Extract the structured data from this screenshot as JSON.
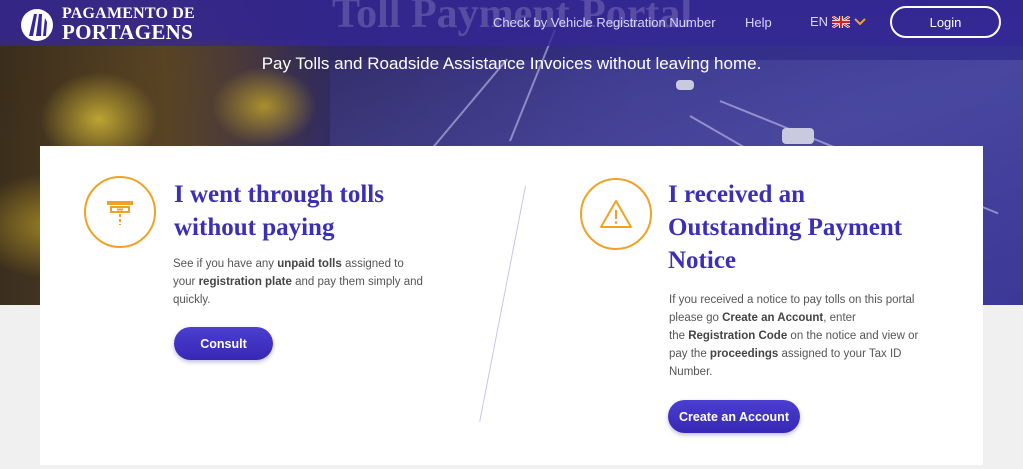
{
  "header": {
    "brand_line1": "PAGAMENTO DE",
    "brand_line2": "PORTAGENS",
    "ghost_title": "Toll Payment Portal",
    "nav": {
      "check_vehicle": "Check by Vehicle Registration Number",
      "help": "Help",
      "lang": "EN"
    },
    "login_label": "Login"
  },
  "hero": {
    "tagline": "Pay Tolls and Roadside Assistance Invoices without leaving home."
  },
  "left_card": {
    "icon": "toll-gate-icon",
    "title_line1": "I went through tolls",
    "title_line2": "without paying",
    "desc": {
      "t1": "See if you have any ",
      "b1": "unpaid tolls",
      "t2": " assigned to",
      "t3": "your ",
      "b2": "registration plate",
      "t4": " and pay them simply and",
      "t5": "quickly."
    },
    "button_label": "Consult"
  },
  "right_card": {
    "icon": "warning-icon",
    "title_line1": "I received an",
    "title_line2": "Outstanding Payment",
    "title_line3": "Notice",
    "desc": {
      "t1": "If you received a notice to pay tolls on this portal",
      "t2": "please go ",
      "b1": "Create an Account",
      "t3": ", enter",
      "t4": "the ",
      "b2": "Registration Code",
      "t5": " on the notice and view or",
      "t6": "pay the ",
      "b3": "proceedings",
      "t7": " assigned to your Tax ID",
      "t8": "Number."
    },
    "button_label": "Create an Account"
  },
  "colors": {
    "primary": "#3b2fb8",
    "accent": "#f0a226",
    "nav_bg": "#3426a0"
  }
}
